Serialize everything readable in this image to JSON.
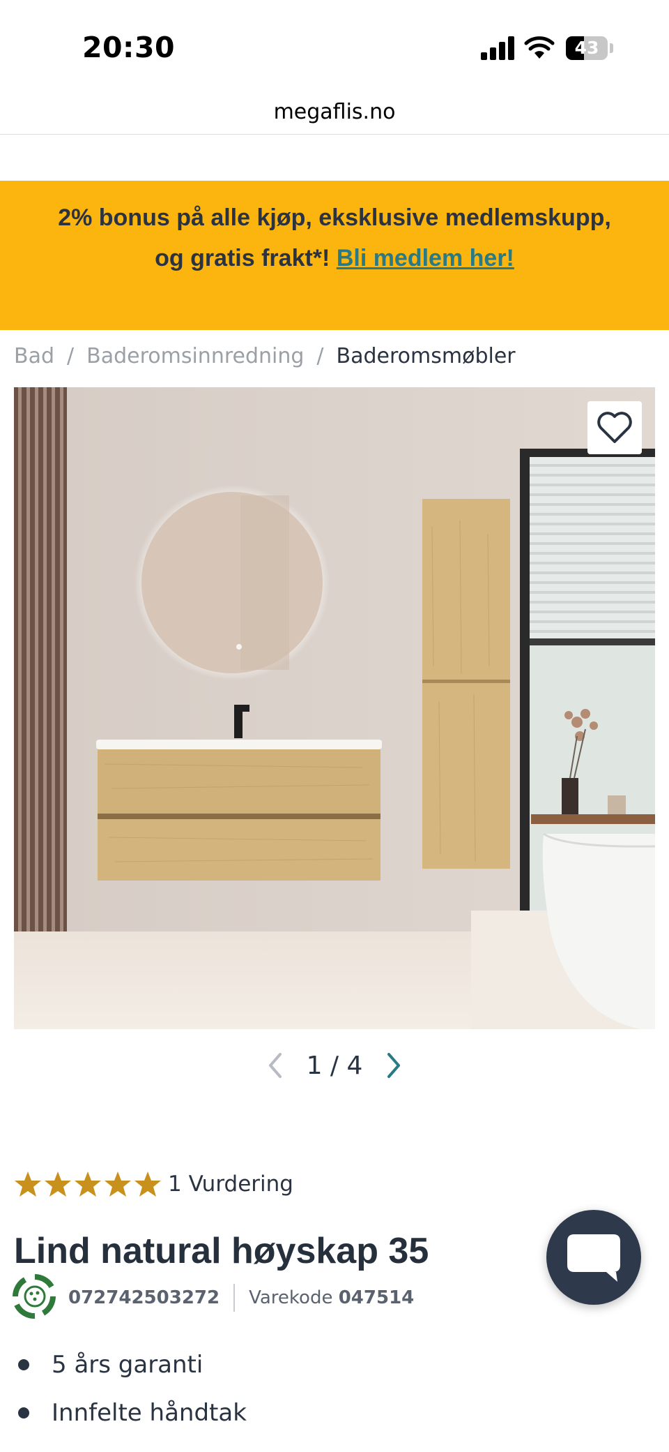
{
  "status_bar": {
    "time": "20:30",
    "battery_percent": "43",
    "battery_level": 0.43
  },
  "browser": {
    "url": "megaflis.no"
  },
  "promo": {
    "text": "2% bonus på alle kjøp, eksklusive medlemskupp, og gratis frakt*!",
    "link": "Bli medlem her!",
    "background_color": "#fbb50e"
  },
  "breadcrumb": {
    "separator": "/",
    "items": [
      "Bad",
      "Baderomsinnredning",
      "Baderomsmøbler"
    ]
  },
  "gallery": {
    "current": "1",
    "separator": "/",
    "total": "4"
  },
  "product": {
    "rating_stars": 5,
    "rating_text": "1 Vurdering",
    "title": "Lind natural høyskap 35",
    "ean": "072742503272",
    "sku_label": "Varekode",
    "sku": "047514",
    "features": [
      "5 års garanti",
      "Innfelte håndtak"
    ]
  },
  "icons": {
    "wishlist": "heart-icon",
    "chat": "chat-bubble-icon",
    "eco": "recycle-icon",
    "star_color": "#c8901c"
  }
}
